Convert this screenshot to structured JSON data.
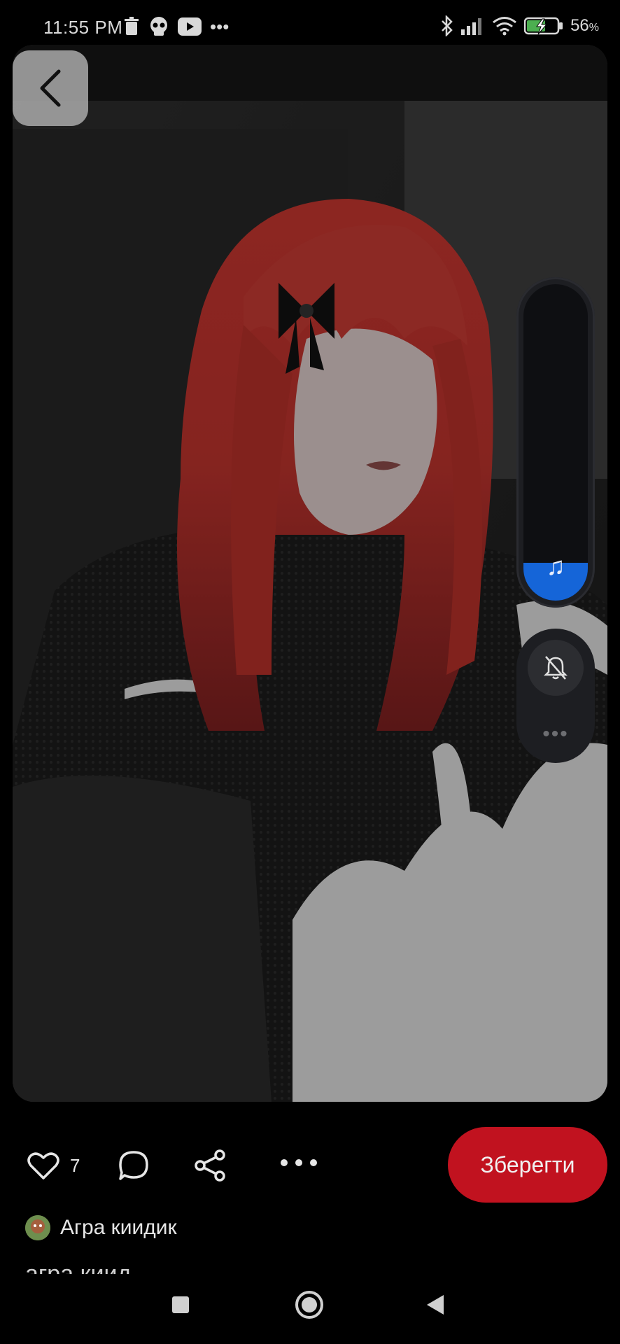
{
  "status_bar": {
    "time": "11:55 PM",
    "battery": "56"
  },
  "post": {
    "like_count": "7",
    "save_label": "Зберегти",
    "author_name": "Агра киидик",
    "caption": "агра киид"
  },
  "volume": {
    "level_fraction": 0.12,
    "accent": "#1565d8"
  },
  "icons": {
    "back": "chevron-left-icon",
    "like": "heart-icon",
    "comment": "comment-bubble-icon",
    "share": "share-icon",
    "more": "more-dots-icon",
    "music": "music-note-icon",
    "mute": "bell-off-icon"
  },
  "colors": {
    "save_button": "#c1121f",
    "background": "#000000"
  }
}
